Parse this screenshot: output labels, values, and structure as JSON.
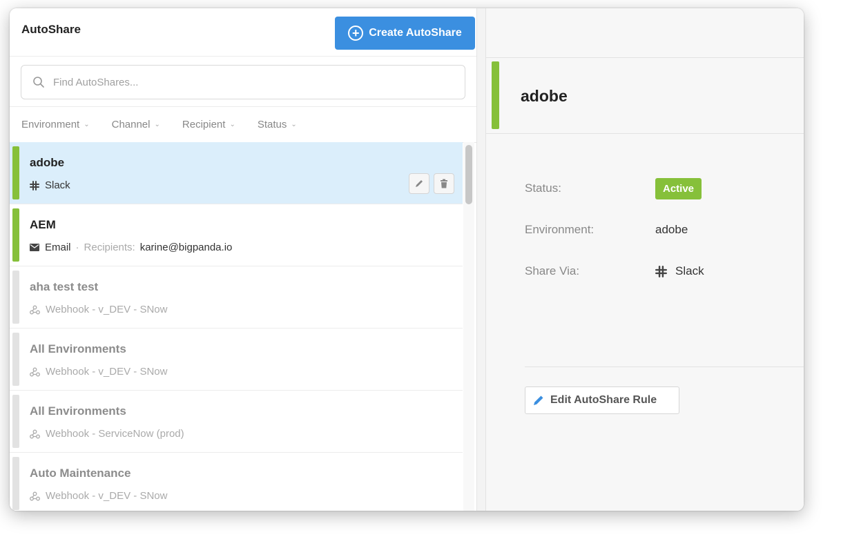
{
  "header": {
    "title": "AutoShare",
    "create_button": "Create AutoShare"
  },
  "search": {
    "placeholder": "Find AutoShares..."
  },
  "filters": [
    "Environment",
    "Channel",
    "Recipient",
    "Status"
  ],
  "list": [
    {
      "name": "adobe",
      "channel_icon": "slack-icon",
      "channel": "Slack",
      "active": true,
      "selected": true
    },
    {
      "name": "AEM",
      "channel_icon": "email-icon",
      "channel": "Email",
      "recipients_label": "Recipients:",
      "recipients": "karine@bigpanda.io",
      "active": true,
      "selected": false
    },
    {
      "name": "aha test test",
      "channel_icon": "webhook-icon",
      "channel": "Webhook - v_DEV - SNow",
      "active": false
    },
    {
      "name": "All Environments",
      "channel_icon": "webhook-icon",
      "channel": "Webhook - v_DEV - SNow",
      "active": false
    },
    {
      "name": "All Environments",
      "channel_icon": "webhook-icon",
      "channel": "Webhook - ServiceNow (prod)",
      "active": false
    },
    {
      "name": "Auto Maintenance",
      "channel_icon": "webhook-icon",
      "channel": "Webhook - v_DEV - SNow",
      "active": false
    }
  ],
  "detail": {
    "title": "adobe",
    "status_label": "Status:",
    "status_value": "Active",
    "environment_label": "Environment:",
    "environment_value": "adobe",
    "share_via_label": "Share Via:",
    "share_via_value": "Slack",
    "edit_button": "Edit AutoShare Rule"
  },
  "colors": {
    "primary": "#3b8fe0",
    "active_green": "#86c03a",
    "selected_bg": "#dbeefb",
    "inactive_bar": "#e2e2e2"
  }
}
